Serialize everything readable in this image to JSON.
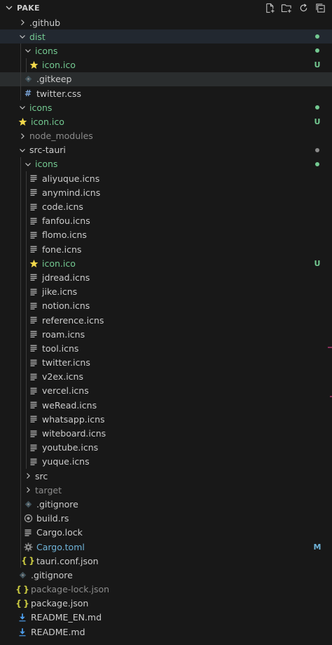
{
  "header": {
    "title": "PAKE",
    "actions": [
      {
        "name": "new-file-icon"
      },
      {
        "name": "new-folder-icon"
      },
      {
        "name": "refresh-icon"
      },
      {
        "name": "collapse-all-icon"
      }
    ]
  },
  "colors": {
    "added": "#73c991",
    "ignored": "#8c8c8c",
    "modified": "#6fb3d8",
    "dot_gray": "#8a8a8a"
  },
  "tree": [
    {
      "label": ".github",
      "depth": 0,
      "type": "folder",
      "open": false
    },
    {
      "label": "dist",
      "depth": 0,
      "type": "folder",
      "open": true,
      "status": "added",
      "dot": true,
      "selected": true
    },
    {
      "label": "icons",
      "depth": 1,
      "type": "folder",
      "open": true,
      "status": "added",
      "dot": true
    },
    {
      "label": "icon.ico",
      "depth": 2,
      "type": "file",
      "icon": "star",
      "status": "added",
      "badge": "U"
    },
    {
      "label": ".gitkeep",
      "depth": 1,
      "type": "file",
      "icon": "gitkeep",
      "hover": true
    },
    {
      "label": "twitter.css",
      "depth": 1,
      "type": "file",
      "icon": "hash"
    },
    {
      "label": "icons",
      "depth": 0,
      "type": "folder",
      "open": true,
      "status": "added",
      "dot": true,
      "folderless": true
    },
    {
      "label": "icon.ico",
      "depth": 0,
      "type": "file",
      "icon": "star",
      "status": "added",
      "badge": "U"
    },
    {
      "label": "node_modules",
      "depth": 0,
      "type": "folder",
      "open": false,
      "status": "ignored"
    },
    {
      "label": "src-tauri",
      "depth": 0,
      "type": "folder",
      "open": true,
      "dot": true,
      "dotGray": true
    },
    {
      "label": "icons",
      "depth": 1,
      "type": "folder",
      "open": true,
      "status": "added",
      "dot": true
    },
    {
      "label": "aliyuque.icns",
      "depth": 2,
      "type": "file",
      "icon": "lines"
    },
    {
      "label": "anymind.icns",
      "depth": 2,
      "type": "file",
      "icon": "lines"
    },
    {
      "label": "code.icns",
      "depth": 2,
      "type": "file",
      "icon": "lines"
    },
    {
      "label": "fanfou.icns",
      "depth": 2,
      "type": "file",
      "icon": "lines"
    },
    {
      "label": "flomo.icns",
      "depth": 2,
      "type": "file",
      "icon": "lines"
    },
    {
      "label": "fone.icns",
      "depth": 2,
      "type": "file",
      "icon": "lines"
    },
    {
      "label": "icon.ico",
      "depth": 2,
      "type": "file",
      "icon": "star",
      "status": "added",
      "badge": "U"
    },
    {
      "label": "jdread.icns",
      "depth": 2,
      "type": "file",
      "icon": "lines"
    },
    {
      "label": "jike.icns",
      "depth": 2,
      "type": "file",
      "icon": "lines"
    },
    {
      "label": "notion.icns",
      "depth": 2,
      "type": "file",
      "icon": "lines"
    },
    {
      "label": "reference.icns",
      "depth": 2,
      "type": "file",
      "icon": "lines"
    },
    {
      "label": "roam.icns",
      "depth": 2,
      "type": "file",
      "icon": "lines"
    },
    {
      "label": "tool.icns",
      "depth": 2,
      "type": "file",
      "icon": "lines"
    },
    {
      "label": "twitter.icns",
      "depth": 2,
      "type": "file",
      "icon": "lines"
    },
    {
      "label": "v2ex.icns",
      "depth": 2,
      "type": "file",
      "icon": "lines"
    },
    {
      "label": "vercel.icns",
      "depth": 2,
      "type": "file",
      "icon": "lines"
    },
    {
      "label": "weRead.icns",
      "depth": 2,
      "type": "file",
      "icon": "lines"
    },
    {
      "label": "whatsapp.icns",
      "depth": 2,
      "type": "file",
      "icon": "lines"
    },
    {
      "label": "witeboard.icns",
      "depth": 2,
      "type": "file",
      "icon": "lines"
    },
    {
      "label": "youtube.icns",
      "depth": 2,
      "type": "file",
      "icon": "lines"
    },
    {
      "label": "yuque.icns",
      "depth": 2,
      "type": "file",
      "icon": "lines"
    },
    {
      "label": "src",
      "depth": 1,
      "type": "folder",
      "open": false
    },
    {
      "label": "target",
      "depth": 1,
      "type": "folder",
      "open": false,
      "status": "ignored"
    },
    {
      "label": ".gitignore",
      "depth": 1,
      "type": "file",
      "icon": "gitkeep"
    },
    {
      "label": "build.rs",
      "depth": 1,
      "type": "file",
      "icon": "rust"
    },
    {
      "label": "Cargo.lock",
      "depth": 1,
      "type": "file",
      "icon": "lines"
    },
    {
      "label": "Cargo.toml",
      "depth": 1,
      "type": "file",
      "icon": "gear",
      "status": "modified",
      "badge": "M"
    },
    {
      "label": "tauri.conf.json",
      "depth": 1,
      "type": "file",
      "icon": "brace"
    },
    {
      "label": ".gitignore",
      "depth": 0,
      "type": "file",
      "icon": "gitkeep"
    },
    {
      "label": "package-lock.json",
      "depth": 0,
      "type": "file",
      "icon": "brace",
      "status": "ignored"
    },
    {
      "label": "package.json",
      "depth": 0,
      "type": "file",
      "icon": "brace"
    },
    {
      "label": "README_EN.md",
      "depth": 0,
      "type": "file",
      "icon": "download"
    },
    {
      "label": "README.md",
      "depth": 0,
      "type": "file",
      "icon": "download"
    }
  ]
}
